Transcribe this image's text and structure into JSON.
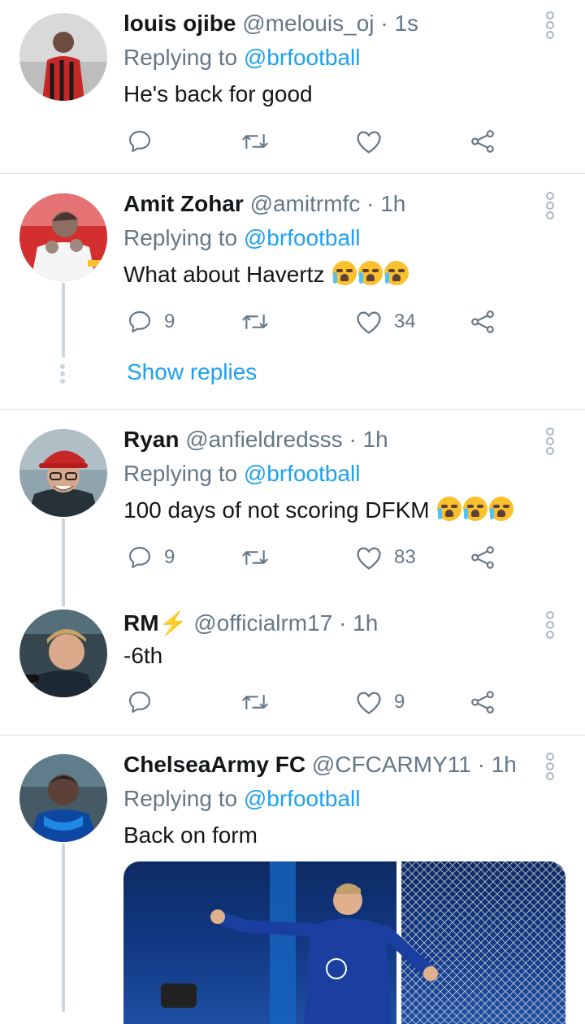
{
  "tweets": [
    {
      "name": "louis ojibe",
      "handle": "@melouis_oj",
      "time": "· 1s",
      "replying_prefix": "Replying to",
      "replying_to": "@brfootball",
      "text": "He's back for good",
      "replies": "",
      "retweets": "",
      "likes": ""
    },
    {
      "name": "Amit Zohar",
      "handle": "@amitrmfc",
      "time": "· 1h",
      "replying_prefix": "Replying to",
      "replying_to": "@brfootball",
      "text": "What about Havertz",
      "emoji_count": 3,
      "replies": "9",
      "retweets": "",
      "likes": "34",
      "show_replies": "Show replies"
    },
    {
      "name": "Ryan",
      "handle": "@anfieldredsss",
      "time": "· 1h",
      "replying_prefix": "Replying to",
      "replying_to": "@brfootball",
      "text": "100 days of not scoring DFKM",
      "emoji_count": 3,
      "replies": "9",
      "retweets": "",
      "likes": "83"
    },
    {
      "name": "RM",
      "name_suffix": "⚡",
      "handle": "@officialrm17",
      "time": "· 1h",
      "text": "-6th",
      "replies": "",
      "retweets": "",
      "likes": "9"
    },
    {
      "name": "ChelseaArmy FC",
      "handle": "@CFCARMY11",
      "time": "· 1h",
      "replying_prefix": "Replying to",
      "replying_to": "@brfootball",
      "text": "Back on form"
    }
  ],
  "colors": {
    "accent": "#1da1f2",
    "muted": "#657786",
    "divider": "#dfe3e6",
    "thread": "#ccd6dd"
  },
  "icons": [
    "reply-icon",
    "retweet-icon",
    "like-icon",
    "share-icon",
    "more-icon"
  ]
}
